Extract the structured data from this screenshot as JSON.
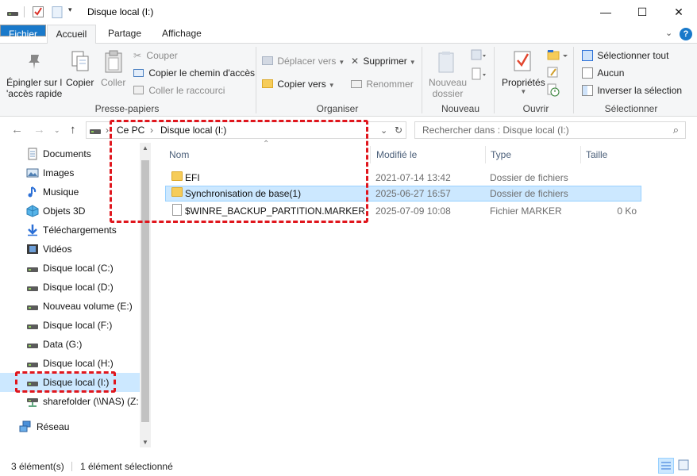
{
  "window": {
    "title": "Disque local (I:)",
    "controls": {
      "minimize": "—",
      "maximize": "☐",
      "close": "✕"
    }
  },
  "ribbon": {
    "tabs": [
      "Fichier",
      "Accueil",
      "Partage",
      "Affichage"
    ],
    "help": "?",
    "groups": {
      "presse_papiers": {
        "label": "Presse-papiers",
        "pin": "Épingler sur l\n'accès rapide",
        "pin_line1": "Épingler sur l",
        "pin_line2": "'accès rapide",
        "copy": "Copier",
        "paste": "Coller",
        "cut": "Couper",
        "copy_path": "Copier le chemin d'accès",
        "paste_shortcut": "Coller le raccourci"
      },
      "organiser": {
        "label": "Organiser",
        "move_to": "Déplacer vers",
        "copy_to": "Copier vers",
        "delete": "Supprimer",
        "rename": "Renommer"
      },
      "nouveau": {
        "label": "Nouveau",
        "new_folder_line1": "Nouveau",
        "new_folder_line2": "dossier"
      },
      "ouvrir": {
        "label": "Ouvrir",
        "properties": "Propriétés"
      },
      "selectionner": {
        "label": "Sélectionner",
        "select_all": "Sélectionner tout",
        "select_none": "Aucun",
        "invert": "Inverser la sélection"
      }
    }
  },
  "address": {
    "breadcrumbs": [
      "Ce PC",
      "Disque local (I:)"
    ],
    "separator": "›",
    "search_placeholder": "Rechercher dans : Disque local (I:)"
  },
  "nav_pane": {
    "items": [
      {
        "label": "Documents",
        "icon": "documents-icon"
      },
      {
        "label": "Images",
        "icon": "images-icon"
      },
      {
        "label": "Musique",
        "icon": "music-icon"
      },
      {
        "label": "Objets 3D",
        "icon": "objects-3d-icon"
      },
      {
        "label": "Téléchargements",
        "icon": "downloads-icon"
      },
      {
        "label": "Vidéos",
        "icon": "videos-icon"
      },
      {
        "label": "Disque local (C:)",
        "icon": "drive-icon"
      },
      {
        "label": "Disque local (D:)",
        "icon": "drive-icon"
      },
      {
        "label": "Nouveau volume (E:)",
        "icon": "drive-icon"
      },
      {
        "label": "Disque local (F:)",
        "icon": "drive-icon"
      },
      {
        "label": "Data (G:)",
        "icon": "drive-icon"
      },
      {
        "label": "Disque local (H:)",
        "icon": "drive-icon"
      },
      {
        "label": "Disque local (I:)",
        "icon": "drive-icon",
        "selected": true
      },
      {
        "label": "sharefolder (\\\\NAS) (Z:",
        "icon": "network-drive-icon"
      },
      {
        "label": "Réseau",
        "icon": "network-icon"
      }
    ]
  },
  "file_list": {
    "columns": {
      "name": "Nom",
      "modified": "Modifié le",
      "type": "Type",
      "size": "Taille"
    },
    "rows": [
      {
        "name": "EFI",
        "modified": "2021-07-14 13:42",
        "type": "Dossier de fichiers",
        "size": "",
        "icon": "folder-icon"
      },
      {
        "name": "Synchronisation de base(1)",
        "modified": "2025-06-27 16:57",
        "type": "Dossier de fichiers",
        "size": "",
        "icon": "folder-icon",
        "selected": true
      },
      {
        "name": "$WINRE_BACKUP_PARTITION.MARKER",
        "modified": "2025-07-09 10:08",
        "type": "Fichier MARKER",
        "size": "0 Ko",
        "icon": "file-icon"
      }
    ]
  },
  "status_bar": {
    "count": "3 élément(s)",
    "selection": "1 élément sélectionné"
  },
  "colors": {
    "accent": "#1979ca",
    "selection": "#cce8ff",
    "highlight": "#e0161d"
  }
}
